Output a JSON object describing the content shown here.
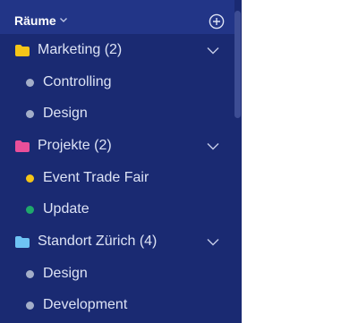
{
  "header": {
    "title": "Räume",
    "add_icon": "plus-circle-icon",
    "chevron_icon": "chevron-down-icon"
  },
  "colors": {
    "sidebar_bg": "#1a2a72",
    "header_bg": "#223587",
    "text": "#dde3f5"
  },
  "groups": [
    {
      "label": "Marketing (2)",
      "folder_color": "#f5c518",
      "items": [
        {
          "label": "Controlling",
          "dot_color": "#a3aec9"
        },
        {
          "label": "Design",
          "dot_color": "#a3aec9"
        }
      ]
    },
    {
      "label": "Projekte (2)",
      "folder_color": "#e94f9a",
      "items": [
        {
          "label": "Event Trade Fair",
          "dot_color": "#f5c518"
        },
        {
          "label": "Update",
          "dot_color": "#1fa86b"
        }
      ]
    },
    {
      "label": "Standort Zürich (4)",
      "folder_color": "#6ec3f4",
      "items": [
        {
          "label": "Design",
          "dot_color": "#a3aec9"
        },
        {
          "label": "Development",
          "dot_color": "#a3aec9"
        }
      ]
    }
  ]
}
